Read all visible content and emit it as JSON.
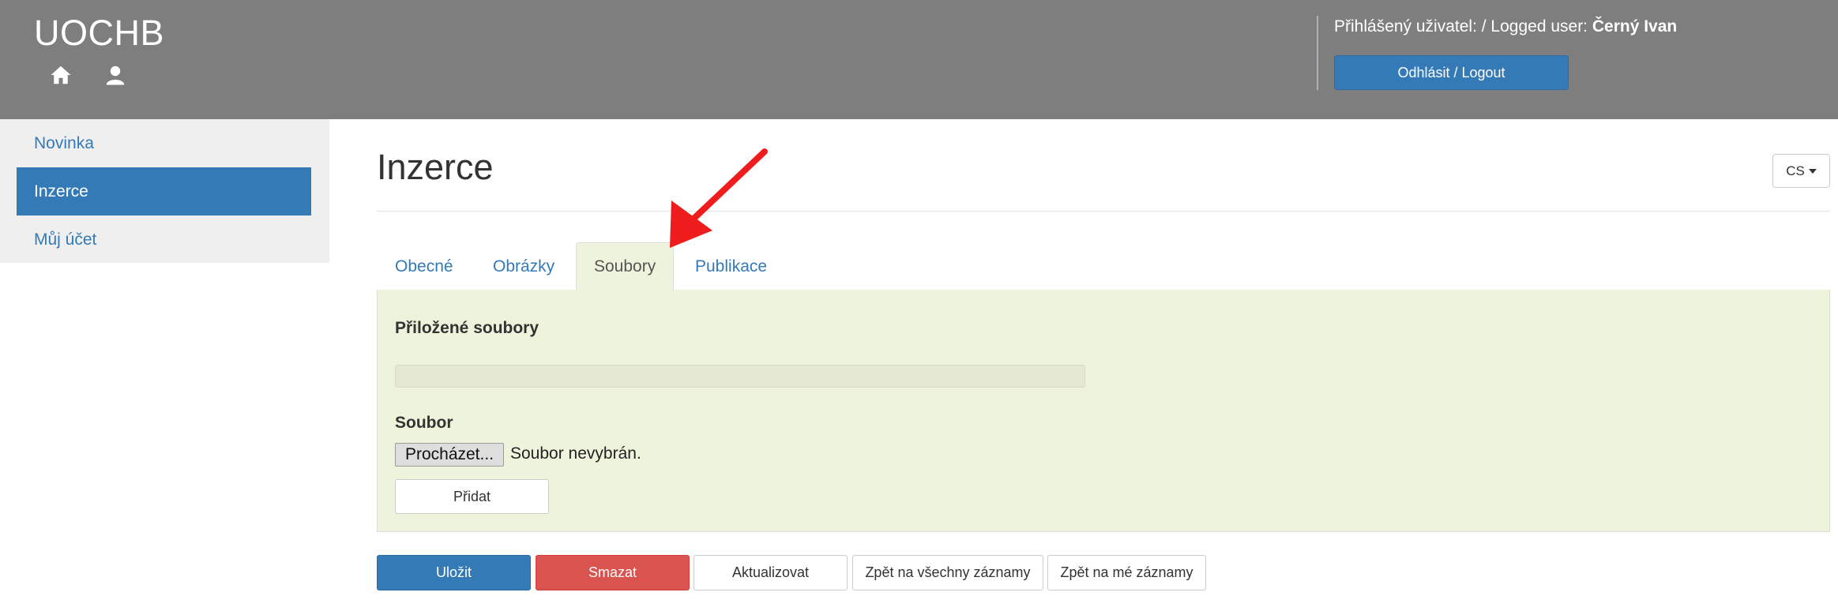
{
  "header": {
    "brand": "UOCHB",
    "logged_prefix": "Přihlášený uživatel: / Logged user: ",
    "logged_user": "Černý Ivan",
    "logout_label": "Odhlásit / Logout",
    "icons": [
      "home-icon",
      "user-icon"
    ]
  },
  "sidebar": {
    "items": [
      {
        "label": "Novinka"
      },
      {
        "label": "Inzerce"
      },
      {
        "label": "Můj účet"
      }
    ]
  },
  "main": {
    "title": "Inzerce",
    "language": "CS",
    "tabs": [
      {
        "label": "Obecné"
      },
      {
        "label": "Obrázky"
      },
      {
        "label": "Soubory"
      },
      {
        "label": "Publikace"
      }
    ],
    "active_tab": "Soubory",
    "panel": {
      "heading": "Přiložené soubory",
      "file_label": "Soubor",
      "browse_label": "Procházet...",
      "no_file_text": "Soubor nevybrán.",
      "add_label": "Přidat"
    },
    "actions": {
      "save": "Uložit",
      "delete": "Smazat",
      "refresh": "Aktualizovat",
      "back_all": "Zpět na všechny záznamy",
      "back_mine": "Zpět na mé záznamy"
    }
  },
  "colors": {
    "header_bg": "#7f7e7f",
    "primary": "#337ab7",
    "danger": "#d9534f",
    "panel_bg": "#eef3db",
    "annotation_arrow": "#ee1c1c"
  }
}
